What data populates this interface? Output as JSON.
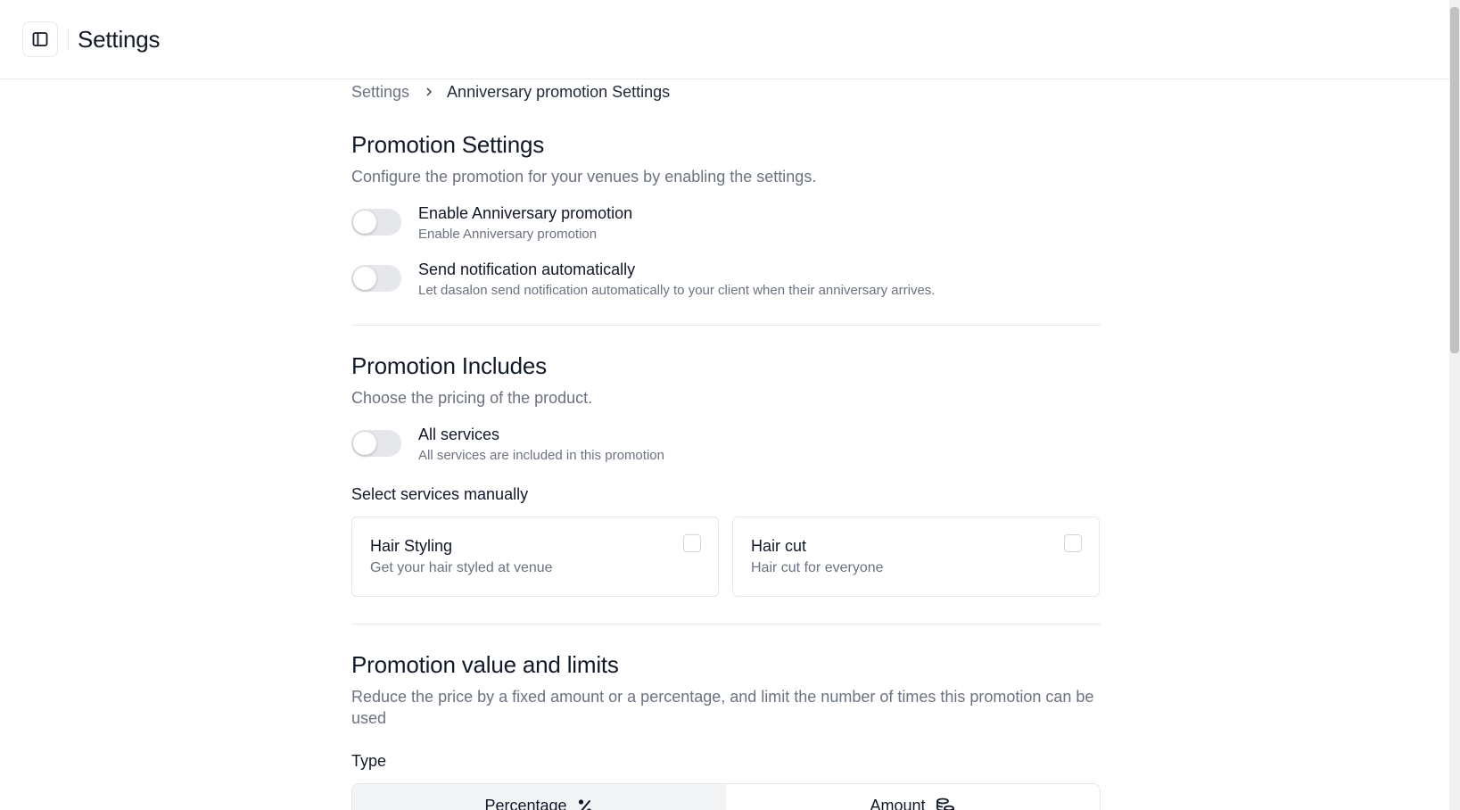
{
  "header": {
    "title": "Settings",
    "toggle_icon": "sidebar-panel-icon"
  },
  "breadcrumb": {
    "items": [
      "Settings",
      "Anniversary promotion Settings"
    ]
  },
  "promotion_settings": {
    "title": "Promotion Settings",
    "description": "Configure the promotion for your venues by enabling the settings.",
    "toggles": [
      {
        "label": "Enable Anniversary promotion",
        "description": "Enable Anniversary promotion",
        "enabled": false
      },
      {
        "label": "Send notification automatically",
        "description": "Let dasalon send notification automatically to your client when their anniversary arrives.",
        "enabled": false
      }
    ]
  },
  "promotion_includes": {
    "title": "Promotion Includes",
    "description": "Choose the pricing of the product.",
    "all_services": {
      "label": "All services",
      "description": "All services are included in this promotion",
      "enabled": false
    },
    "manual_label": "Select services manually",
    "services": [
      {
        "name": "Hair Styling",
        "description": "Get your hair styled at venue",
        "checked": false
      },
      {
        "name": "Hair cut",
        "description": "Hair cut for everyone",
        "checked": false
      }
    ]
  },
  "promotion_value": {
    "title": "Promotion value and limits",
    "description": "Reduce the price by a fixed amount or a percentage, and limit the number of times this promotion can be used",
    "type_label": "Type",
    "types": [
      {
        "label": "Percentage",
        "icon": "percent-icon",
        "active": true
      },
      {
        "label": "Amount",
        "icon": "coins-icon",
        "active": false
      }
    ]
  }
}
